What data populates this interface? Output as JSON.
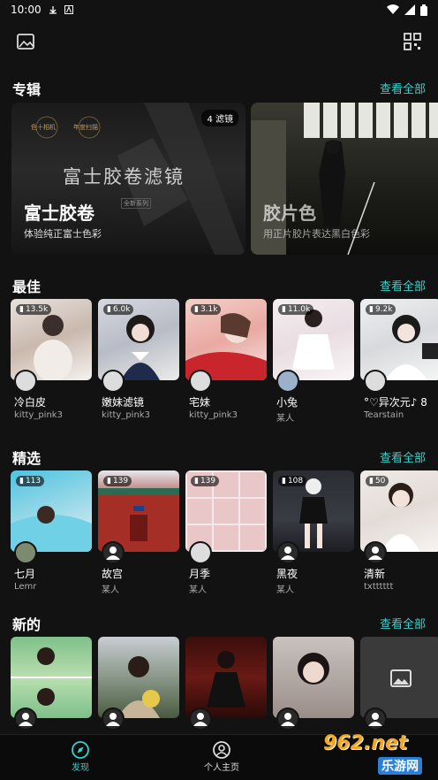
{
  "status": {
    "time": "10:00"
  },
  "sections": {
    "albums": {
      "title": "专辑",
      "see_all": "查看全部"
    },
    "best": {
      "title": "最佳",
      "see_all": "查看全部"
    },
    "featured": {
      "title": "精选",
      "see_all": "查看全部"
    },
    "new": {
      "title": "新的",
      "see_all": "查看全部"
    }
  },
  "albums": [
    {
      "tag": "4 滤镜",
      "title": "富士胶卷",
      "desc": "体验纯正富士色彩",
      "overlay_text": "富士胶卷滤镜",
      "badge1": "色十相机",
      "badge2": "年度扫描",
      "series": "全新系列"
    },
    {
      "title": "胶片色",
      "desc": "用正片胶片表达黑白色彩"
    }
  ],
  "best": [
    {
      "count": "13.5k",
      "name": "冷白皮",
      "author": "kitty_pink3"
    },
    {
      "count": "6.0k",
      "name": "嫩妹滤镜",
      "author": "kitty_pink3"
    },
    {
      "count": "3.1k",
      "name": "宅妹",
      "author": "kitty_pink3"
    },
    {
      "count": "11.0k",
      "name": "小兔",
      "author": "某人"
    },
    {
      "count": "9.2k",
      "name": "°♡异次元♪ 8",
      "author": "Tearstain"
    }
  ],
  "featured": [
    {
      "count": "113",
      "name": "七月",
      "author": "Lemr"
    },
    {
      "count": "139",
      "name": "故宫",
      "author": "某人"
    },
    {
      "count": "139",
      "name": "月季",
      "author": "某人"
    },
    {
      "count": "108",
      "name": "黑夜",
      "author": "某人"
    },
    {
      "count": "50",
      "name": "清新",
      "author": "txtttttt"
    }
  ],
  "nav": {
    "discover": "发现",
    "profile": "个人主页"
  },
  "watermark": {
    "brand": "962.net",
    "site": "乐游网"
  },
  "colors": {
    "accent": "#37d0ca",
    "background": "#121212"
  }
}
